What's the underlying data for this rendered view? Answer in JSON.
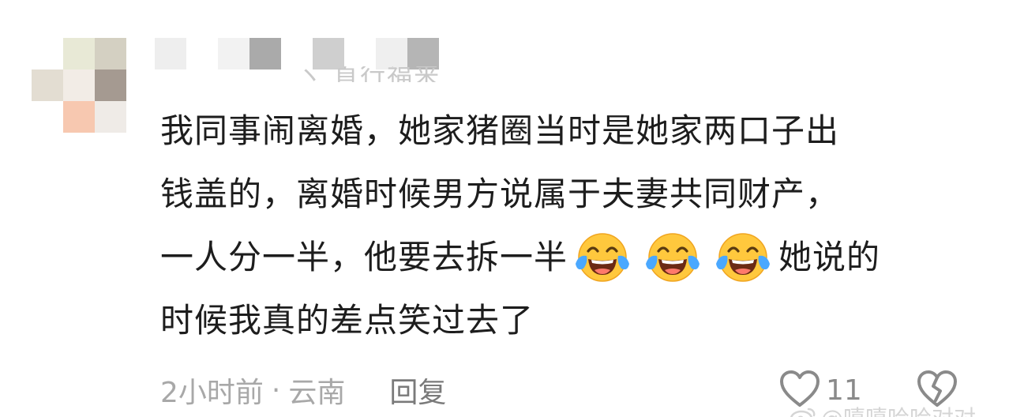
{
  "comment": {
    "lines": [
      "我同事闹离婚，她家猪圈当时是她家两口子出",
      "钱盖的，离婚时候男方说属于夫妻共同财产，",
      "一人分一半，他要去拆一半",
      "她说的",
      "时候我真的差点笑过去了"
    ],
    "emojis": [
      "tears-of-joy-icon",
      "tears-of-joy-icon",
      "tears-of-joy-icon"
    ]
  },
  "meta": {
    "time": "2小时前",
    "separator": "·",
    "location": "云南",
    "reply_label": "回复"
  },
  "likes": {
    "count": "11"
  },
  "watermark": {
    "text": "@嘻嘻哈哈对对"
  },
  "colors": {
    "text": "#1d1d1d",
    "meta": "#a8a8a8",
    "icon": "#8a8a8a",
    "emoji_face": "#ffc83d",
    "emoji_tear": "#4aa8ff"
  }
}
